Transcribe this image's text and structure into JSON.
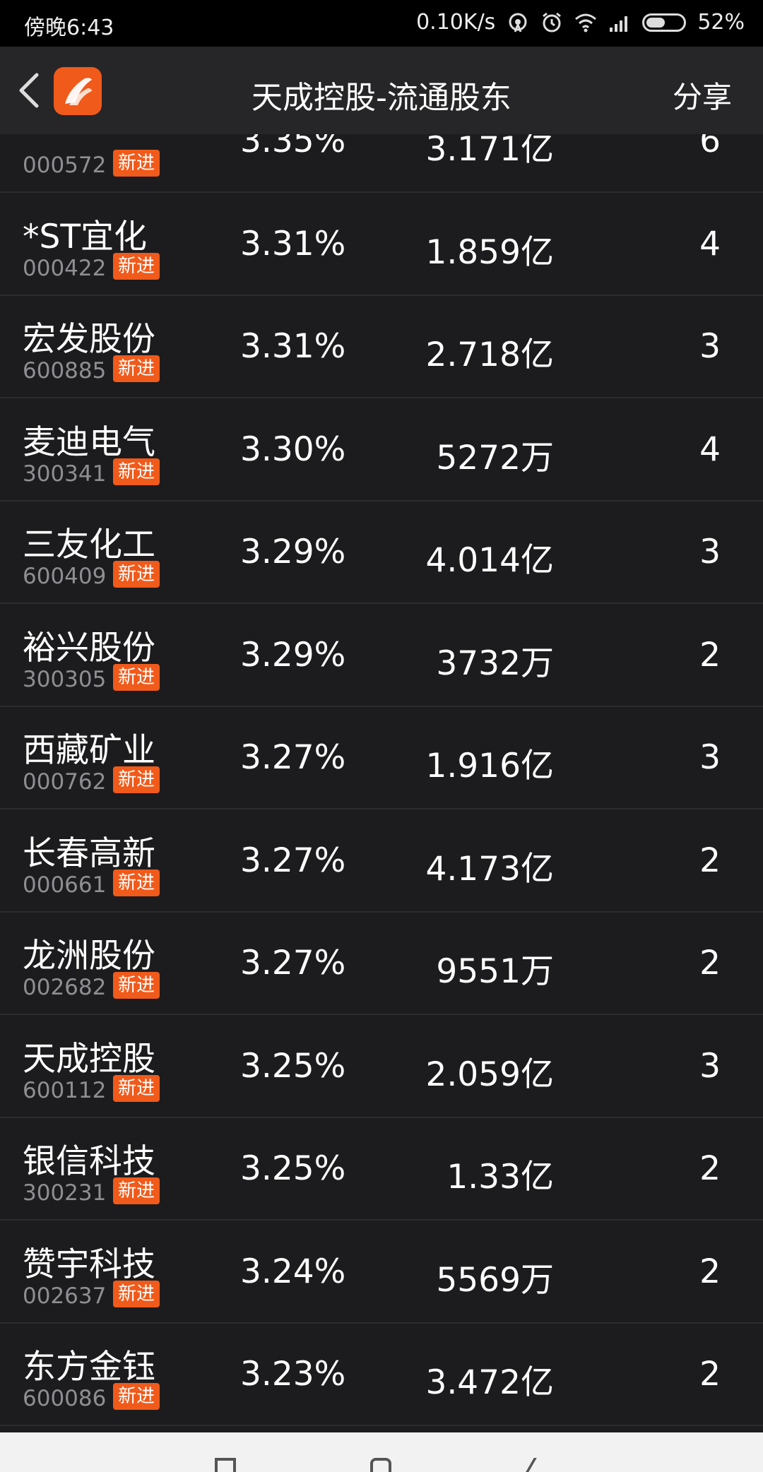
{
  "status_bar": {
    "time": "傍晚6:43",
    "speed": "0.10K/s",
    "battery": "52%",
    "battery_level": 0.52
  },
  "header": {
    "title": "天成控股-流通股东",
    "share": "分享"
  },
  "rows": [
    {
      "name": "",
      "code": "000572",
      "badge": "新进",
      "pct": "3.35%",
      "amt": "3.171亿",
      "cnt": "6"
    },
    {
      "name": "*ST宜化",
      "code": "000422",
      "badge": "新进",
      "pct": "3.31%",
      "amt": "1.859亿",
      "cnt": "4"
    },
    {
      "name": "宏发股份",
      "code": "600885",
      "badge": "新进",
      "pct": "3.31%",
      "amt": "2.718亿",
      "cnt": "3"
    },
    {
      "name": "麦迪电气",
      "code": "300341",
      "badge": "新进",
      "pct": "3.30%",
      "amt": "5272万",
      "cnt": "4"
    },
    {
      "name": "三友化工",
      "code": "600409",
      "badge": "新进",
      "pct": "3.29%",
      "amt": "4.014亿",
      "cnt": "3"
    },
    {
      "name": "裕兴股份",
      "code": "300305",
      "badge": "新进",
      "pct": "3.29%",
      "amt": "3732万",
      "cnt": "2"
    },
    {
      "name": "西藏矿业",
      "code": "000762",
      "badge": "新进",
      "pct": "3.27%",
      "amt": "1.916亿",
      "cnt": "3"
    },
    {
      "name": "长春高新",
      "code": "000661",
      "badge": "新进",
      "pct": "3.27%",
      "amt": "4.173亿",
      "cnt": "2"
    },
    {
      "name": "龙洲股份",
      "code": "002682",
      "badge": "新进",
      "pct": "3.27%",
      "amt": "9551万",
      "cnt": "2"
    },
    {
      "name": "天成控股",
      "code": "600112",
      "badge": "新进",
      "pct": "3.25%",
      "amt": "2.059亿",
      "cnt": "3"
    },
    {
      "name": "银信科技",
      "code": "300231",
      "badge": "新进",
      "pct": "3.25%",
      "amt": "1.33亿",
      "cnt": "2"
    },
    {
      "name": "赞宇科技",
      "code": "002637",
      "badge": "新进",
      "pct": "3.24%",
      "amt": "5569万",
      "cnt": "2"
    },
    {
      "name": "东方金钰",
      "code": "600086",
      "badge": "新进",
      "pct": "3.23%",
      "amt": "3.472亿",
      "cnt": "2"
    }
  ],
  "colors": {
    "accent": "#f05a1a",
    "background": "#1c1c1e",
    "header": "#262628"
  }
}
